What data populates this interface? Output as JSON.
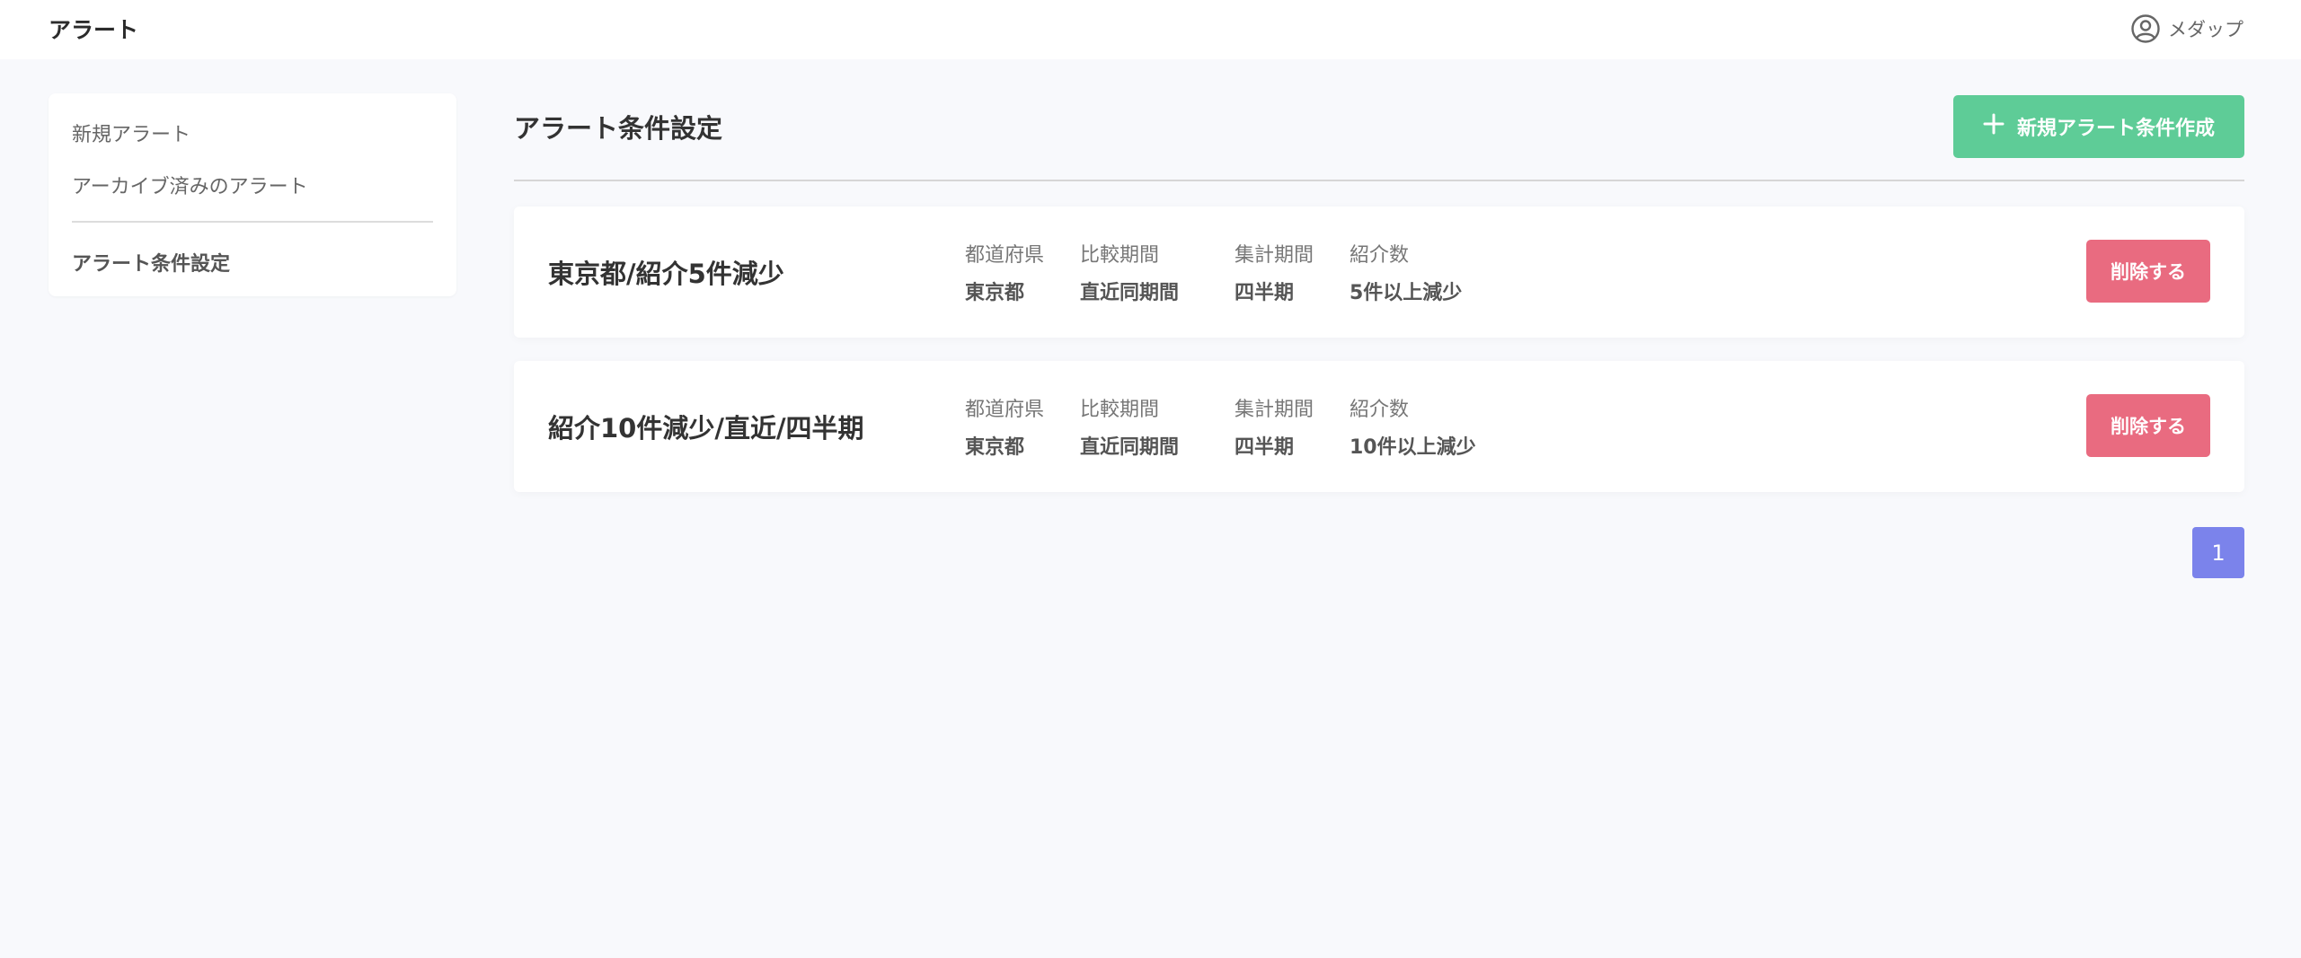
{
  "header": {
    "title": "アラート",
    "user_name": "メダップ",
    "user_icon": "user-circle-icon"
  },
  "sidebar": {
    "items": [
      {
        "label": "新規アラート"
      },
      {
        "label": "アーカイブ済みのアラート"
      },
      {
        "label": "アラート条件設定",
        "active": true
      }
    ]
  },
  "main": {
    "title": "アラート条件設定",
    "create_button": {
      "label": "新規アラート条件作成",
      "icon": "plus-icon"
    },
    "columns": [
      "都道府県",
      "比較期間",
      "集計期間",
      "紹介数"
    ],
    "conditions": [
      {
        "name": "東京都/紹介5件減少",
        "values": [
          "東京都",
          "直近同期間",
          "四半期",
          "5件以上減少"
        ],
        "delete_label": "削除する"
      },
      {
        "name": "紹介10件減少/直近/四半期",
        "values": [
          "東京都",
          "直近同期間",
          "四半期",
          "10件以上減少"
        ],
        "delete_label": "削除する"
      }
    ],
    "pagination": {
      "current_page": "1"
    }
  },
  "colors": {
    "create_button": "#5ecc97",
    "delete_button": "#e96b80",
    "pagination_active": "#7b83eb",
    "background": "#f8f9fc"
  }
}
